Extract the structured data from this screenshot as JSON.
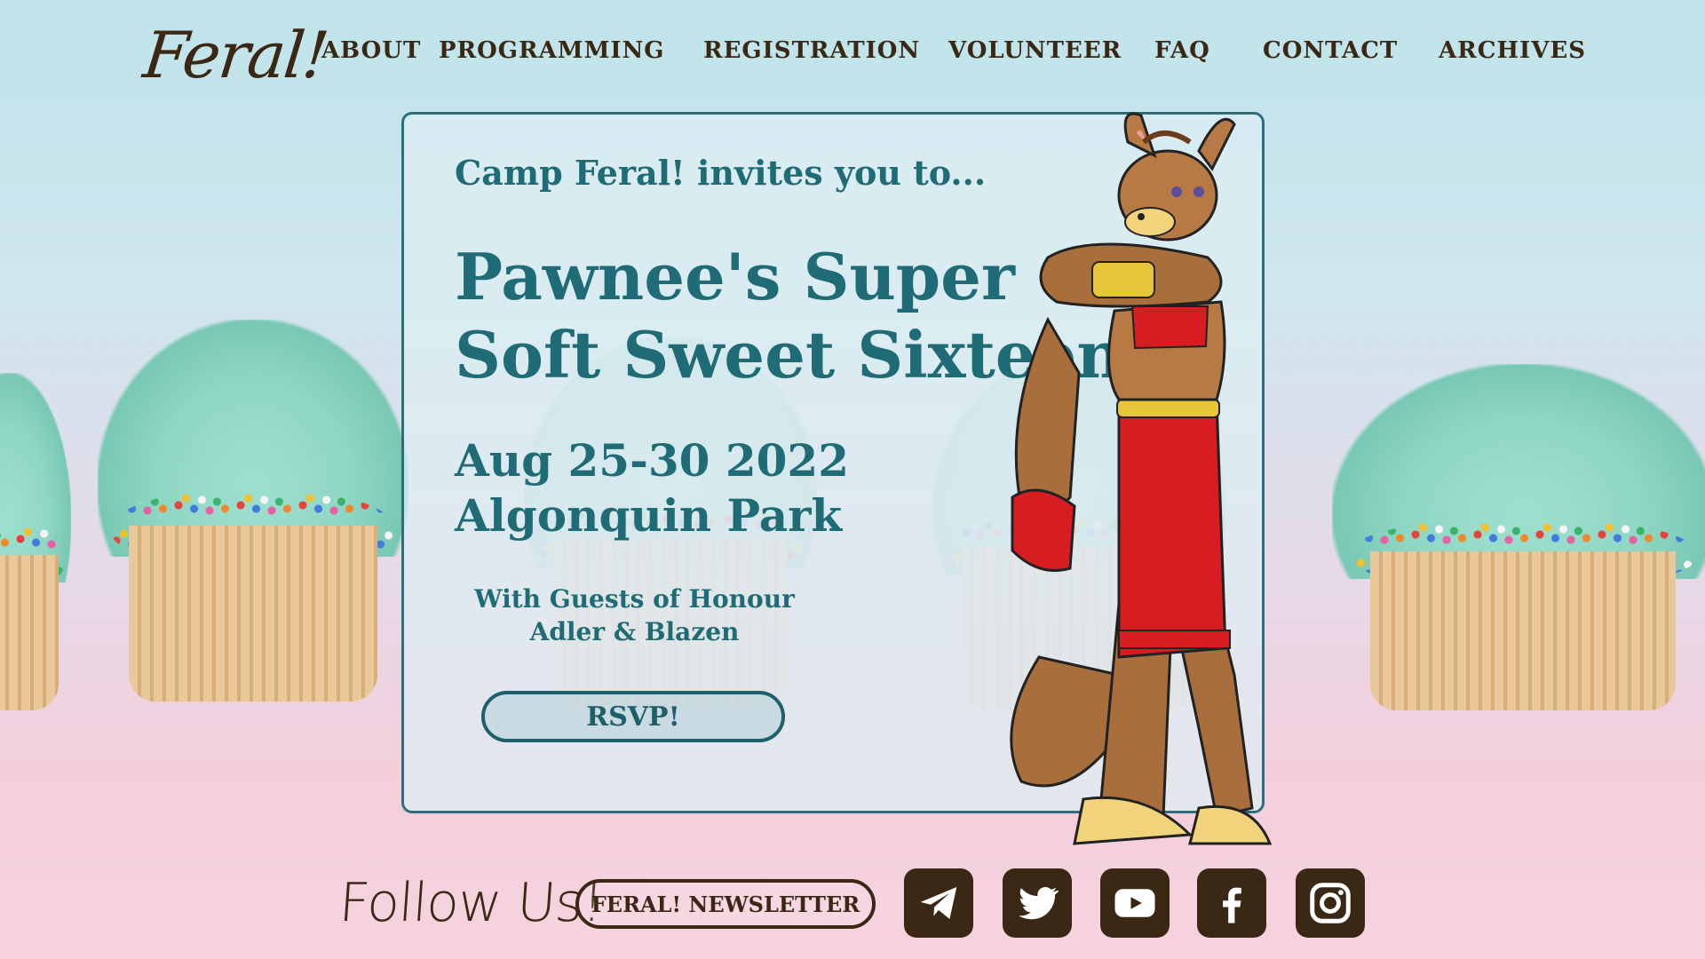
{
  "header": {
    "logo_text": "Feral!",
    "nav": [
      {
        "id": "about",
        "label": "ABOUT"
      },
      {
        "id": "programming",
        "label": "PROGRAMMING"
      },
      {
        "id": "registration",
        "label": "REGISTRATION"
      },
      {
        "id": "volunteer",
        "label": "VOLUNTEER"
      },
      {
        "id": "faq",
        "label": "FAQ"
      },
      {
        "id": "contact",
        "label": "CONTACT"
      },
      {
        "id": "archives",
        "label": "ARCHIVES"
      }
    ]
  },
  "hero": {
    "eyebrow": "Camp Feral! invites you to...",
    "title_line1": "Pawnee's Super",
    "title_line2": "Soft Sweet Sixteen",
    "date": "Aug 25-30 2022",
    "location": "Algonquin Park",
    "guests_line1": "With Guests of Honour",
    "guests_line2": "Adler & Blazen",
    "rsvp_label": "RSVP!"
  },
  "footer": {
    "follow_text": "Follow Us!",
    "newsletter_label": "FERAL! NEWSLETTER",
    "social": [
      "telegram-icon",
      "twitter-icon",
      "youtube-icon",
      "facebook-icon",
      "instagram-icon"
    ]
  },
  "colors": {
    "accent_teal": "#1f6b76",
    "brown": "#3a2814",
    "frosting": "#8fd6c4"
  }
}
